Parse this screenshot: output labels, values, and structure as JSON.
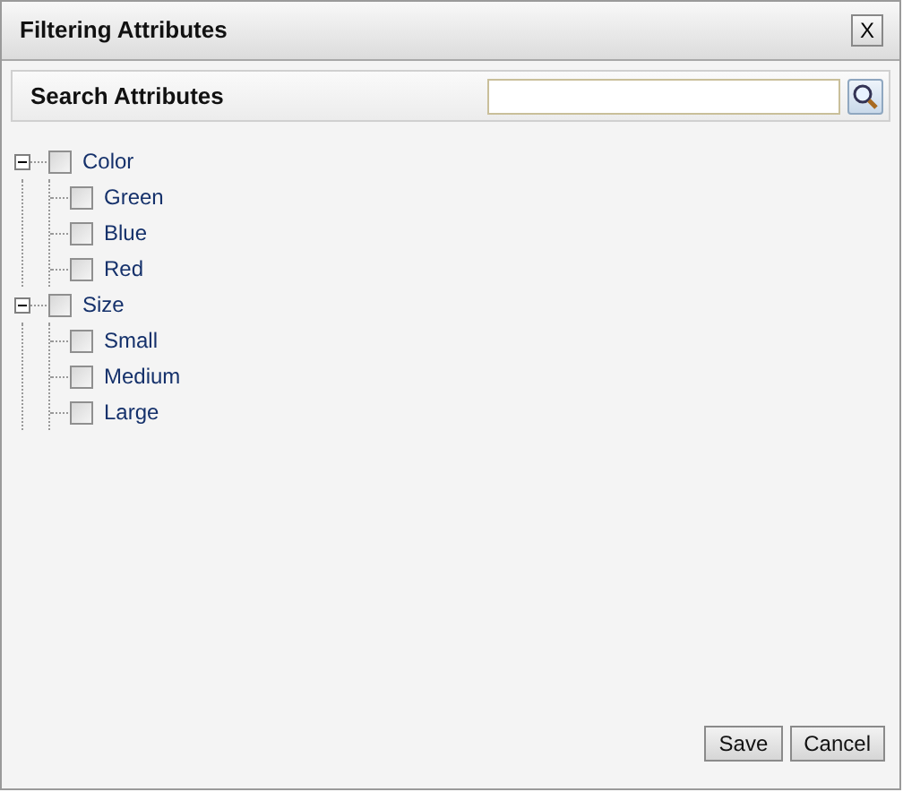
{
  "window": {
    "title": "Filtering Attributes",
    "close": "X"
  },
  "search": {
    "label": "Search Attributes"
  },
  "tree": [
    {
      "label": "Color",
      "checked": false,
      "expanded": true,
      "children": [
        {
          "label": "Green",
          "checked": false
        },
        {
          "label": "Blue",
          "checked": false
        },
        {
          "label": "Red",
          "checked": false
        }
      ]
    },
    {
      "label": "Size",
      "checked": false,
      "expanded": true,
      "children": [
        {
          "label": "Small",
          "checked": false
        },
        {
          "label": "Medium",
          "checked": false
        },
        {
          "label": "Large",
          "checked": false
        }
      ]
    }
  ],
  "buttons": [
    "Save",
    "Cancel"
  ]
}
